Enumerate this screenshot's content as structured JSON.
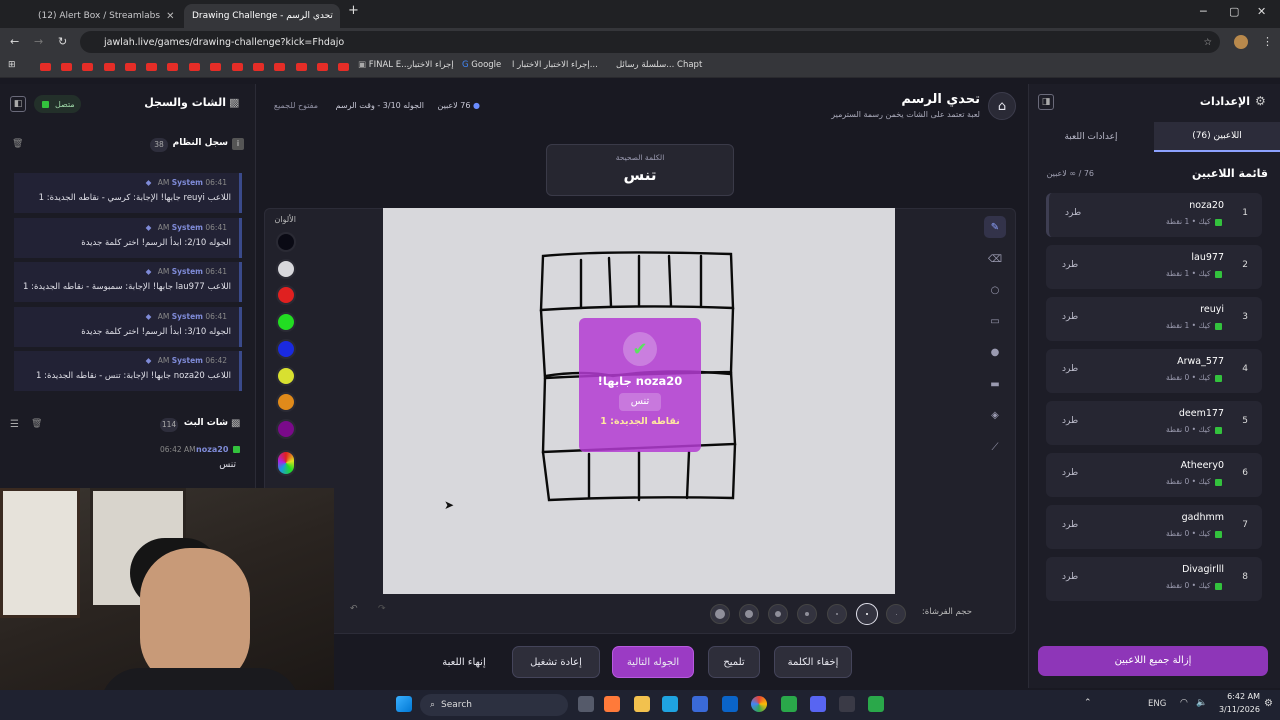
{
  "browser": {
    "tabs": [
      {
        "title": "(12) Alert Box / Streamlabs"
      },
      {
        "title": "Drawing Challenge - تحدي الرسم"
      }
    ],
    "url": "jawlah.live/games/drawing-challenge?kick=Fhdajo",
    "bookmarks": [
      "FINAL E...",
      "إجراء الاختبار",
      "Google",
      "إجراء الاختبار الاختبار ا...",
      "سلسلة رسائل... Chapt"
    ]
  },
  "header": {
    "title": "تحدي الرسم",
    "subtitle": "لعبة تعتمد على الشات يخمن رسمة السترمير",
    "players_count": "76 لاعبين",
    "round_info": "الجوله 3/10 - وقت الرسم",
    "open_status": "مفتوح للجميع"
  },
  "word_box": {
    "label": "الكلمة الصحيحة",
    "word": "تنس"
  },
  "left_panel": {
    "title": "الشات والسجل",
    "status": "متصل",
    "system_log_title": "سجل النظام",
    "system_log_count": "38",
    "messages": [
      {
        "sender": "System",
        "time": "06:41 AM",
        "text": "اللاعب reuyi جابها! الإجابة: كرسي - نقاطه الجديدة: 1"
      },
      {
        "sender": "System",
        "time": "06:41 AM",
        "text": "الجوله 2/10: ابدأ الرسم! اختر كلمة جديدة"
      },
      {
        "sender": "System",
        "time": "06:41 AM",
        "text": "اللاعب lau977 جابها! الإجابة: سمبوسة - نقاطه الجديدة: 1"
      },
      {
        "sender": "System",
        "time": "06:41 AM",
        "text": "الجوله 3/10: ابدأ الرسم! اختر كلمة جديدة"
      },
      {
        "sender": "System",
        "time": "06:42 AM",
        "text": "اللاعب noza20 جابها! الإجابة: تنس - نقاطه الجديدة: 1"
      }
    ],
    "stream_chat_title": "شات البث",
    "stream_chat_count": "114",
    "chat_message": {
      "user": "noza20",
      "time": "06:42 AM",
      "text": "تنس"
    }
  },
  "canvas": {
    "colors_label": "الألوان",
    "colors": [
      "#0a0a14",
      "#d8d8dc",
      "#e02020",
      "#22dd22",
      "#1a2ae0",
      "#d8e030",
      "#e08a1a",
      "#7a0a8a"
    ],
    "brush_size_label": "حجم الفرشاة:",
    "correct_popup": {
      "title": "noza20 جابها!",
      "word": "تنس",
      "points": "نقاطه الجديدة: 1"
    }
  },
  "bottom_buttons": {
    "hide_word": "إخفاء الكلمة",
    "hint": "تلميح",
    "next_round": "الجوله التالية",
    "restart": "إعادة تشغيل",
    "end_game": "إنهاء اللعبة"
  },
  "right_panel": {
    "title": "الإعدادات",
    "tab_players": "اللاعبين (76)",
    "tab_settings": "إعدادات اللعبة",
    "list_title": "قائمة اللاعبين",
    "list_count": "76 / ∞ لاعبين",
    "kick_label": "طرد",
    "remove_all": "إزالة جميع اللاعبين",
    "players": [
      {
        "rank": "1",
        "name": "noza20",
        "points": "كيك • 1 نقطة"
      },
      {
        "rank": "2",
        "name": "lau977",
        "points": "كيك • 1 نقطة"
      },
      {
        "rank": "3",
        "name": "reuyi",
        "points": "كيك • 1 نقطة"
      },
      {
        "rank": "4",
        "name": "Arwa_577",
        "points": "كيك • 0 نقطة"
      },
      {
        "rank": "5",
        "name": "deem177",
        "points": "كيك • 0 نقطة"
      },
      {
        "rank": "6",
        "name": "Atheery0",
        "points": "كيك • 0 نقطة"
      },
      {
        "rank": "7",
        "name": "gadhmm",
        "points": "كيك • 0 نقطة"
      },
      {
        "rank": "8",
        "name": "Divagirlll",
        "points": "كيك • 0 نقطة"
      }
    ]
  },
  "taskbar": {
    "search": "Search",
    "lang": "ENG",
    "time": "6:42 AM",
    "date": "3/11/2026"
  }
}
